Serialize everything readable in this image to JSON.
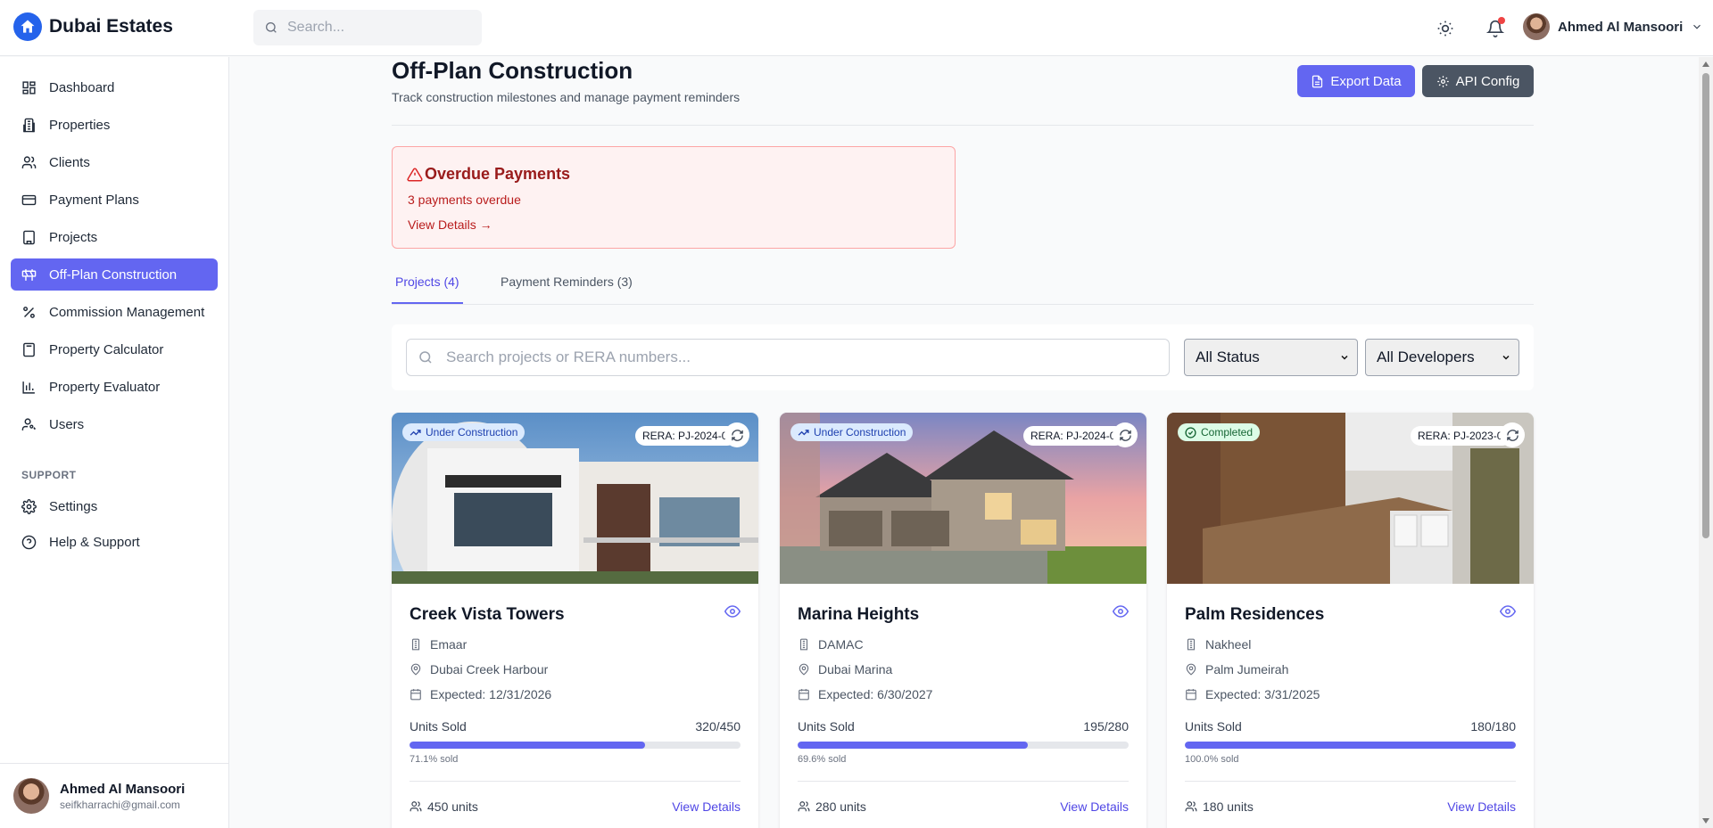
{
  "brand": {
    "name": "Dubai Estates",
    "accent": "#2563eb"
  },
  "topbar": {
    "search_placeholder": "Search...",
    "user_name": "Ahmed Al Mansoori",
    "has_notification": true
  },
  "sidebar": {
    "items": [
      {
        "label": "Dashboard",
        "icon": "dashboard-icon"
      },
      {
        "label": "Properties",
        "icon": "building-icon"
      },
      {
        "label": "Clients",
        "icon": "users-icon"
      },
      {
        "label": "Payment Plans",
        "icon": "credit-card-icon"
      },
      {
        "label": "Projects",
        "icon": "office-icon"
      },
      {
        "label": "Off-Plan Construction",
        "icon": "construction-icon",
        "active": true
      },
      {
        "label": "Commission Management",
        "icon": "percent-icon"
      },
      {
        "label": "Property Calculator",
        "icon": "calculator-icon"
      },
      {
        "label": "Property Evaluator",
        "icon": "bar-chart-icon"
      },
      {
        "label": "Users",
        "icon": "user-key-icon"
      }
    ],
    "support_label": "SUPPORT",
    "support_items": [
      {
        "label": "Settings",
        "icon": "gear-icon"
      },
      {
        "label": "Help & Support",
        "icon": "help-icon"
      }
    ],
    "user": {
      "name": "Ahmed Al Mansoori",
      "email": "seifkharrachi@gmail.com"
    }
  },
  "page": {
    "title": "Off-Plan Construction",
    "subtitle": "Track construction milestones and manage payment reminders",
    "export_label": "Export Data",
    "api_label": "API Config"
  },
  "alert": {
    "title": "Overdue Payments",
    "text": "3 payments overdue",
    "link": "View Details →"
  },
  "tabs": [
    {
      "label": "Projects (4)",
      "active": true
    },
    {
      "label": "Payment Reminders (3)",
      "active": false
    }
  ],
  "filters": {
    "search_placeholder": "Search projects or RERA numbers...",
    "status_value": "All Status",
    "developer_value": "All Developers"
  },
  "projects": [
    {
      "name": "Creek Vista Towers",
      "status": "Under Construction",
      "rera": "RERA: PJ-2024-0",
      "developer": "Emaar",
      "location": "Dubai Creek Harbour",
      "expected": "Expected: 12/31/2026",
      "units_label": "Units Sold",
      "units_sold": "320/450",
      "sold_fraction": 0.711,
      "sold_text": "71.1% sold",
      "total_units": "450 units",
      "view_label": "View Details"
    },
    {
      "name": "Marina Heights",
      "status": "Under Construction",
      "rera": "RERA: PJ-2024-0",
      "developer": "DAMAC",
      "location": "Dubai Marina",
      "expected": "Expected: 6/30/2027",
      "units_label": "Units Sold",
      "units_sold": "195/280",
      "sold_fraction": 0.696,
      "sold_text": "69.6% sold",
      "total_units": "280 units",
      "view_label": "View Details"
    },
    {
      "name": "Palm Residences",
      "status": "Completed",
      "rera": "RERA: PJ-2023-0",
      "developer": "Nakheel",
      "location": "Palm Jumeirah",
      "expected": "Expected: 3/31/2025",
      "units_label": "Units Sold",
      "units_sold": "180/180",
      "sold_fraction": 1.0,
      "sold_text": "100.0% sold",
      "total_units": "180 units",
      "view_label": "View Details"
    }
  ]
}
